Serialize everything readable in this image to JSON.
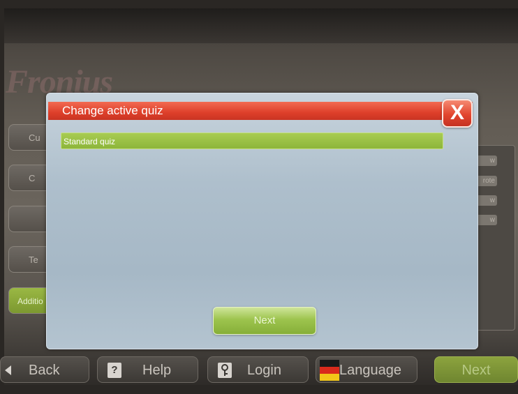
{
  "brand": {
    "logo_text": "Fronius"
  },
  "background": {
    "left_buttons": [
      "Cu",
      "C",
      "",
      "Te",
      "Additio"
    ],
    "right_tags": [
      "w",
      "rote",
      "w",
      "w"
    ]
  },
  "dialog": {
    "title": "Change active quiz",
    "close_label": "X",
    "quizzes": [
      {
        "label": "Standard quiz"
      }
    ],
    "next_label": "Next"
  },
  "toolbar": {
    "back_label": "Back",
    "help_label": "Help",
    "help_icon_glyph": "?",
    "login_label": "Login",
    "language_label": "Language",
    "next_label": "Next"
  },
  "colors": {
    "title_bar": "#de3f2a",
    "selected_item": "#8db63a",
    "dialog_bg": "#aebfcc"
  }
}
